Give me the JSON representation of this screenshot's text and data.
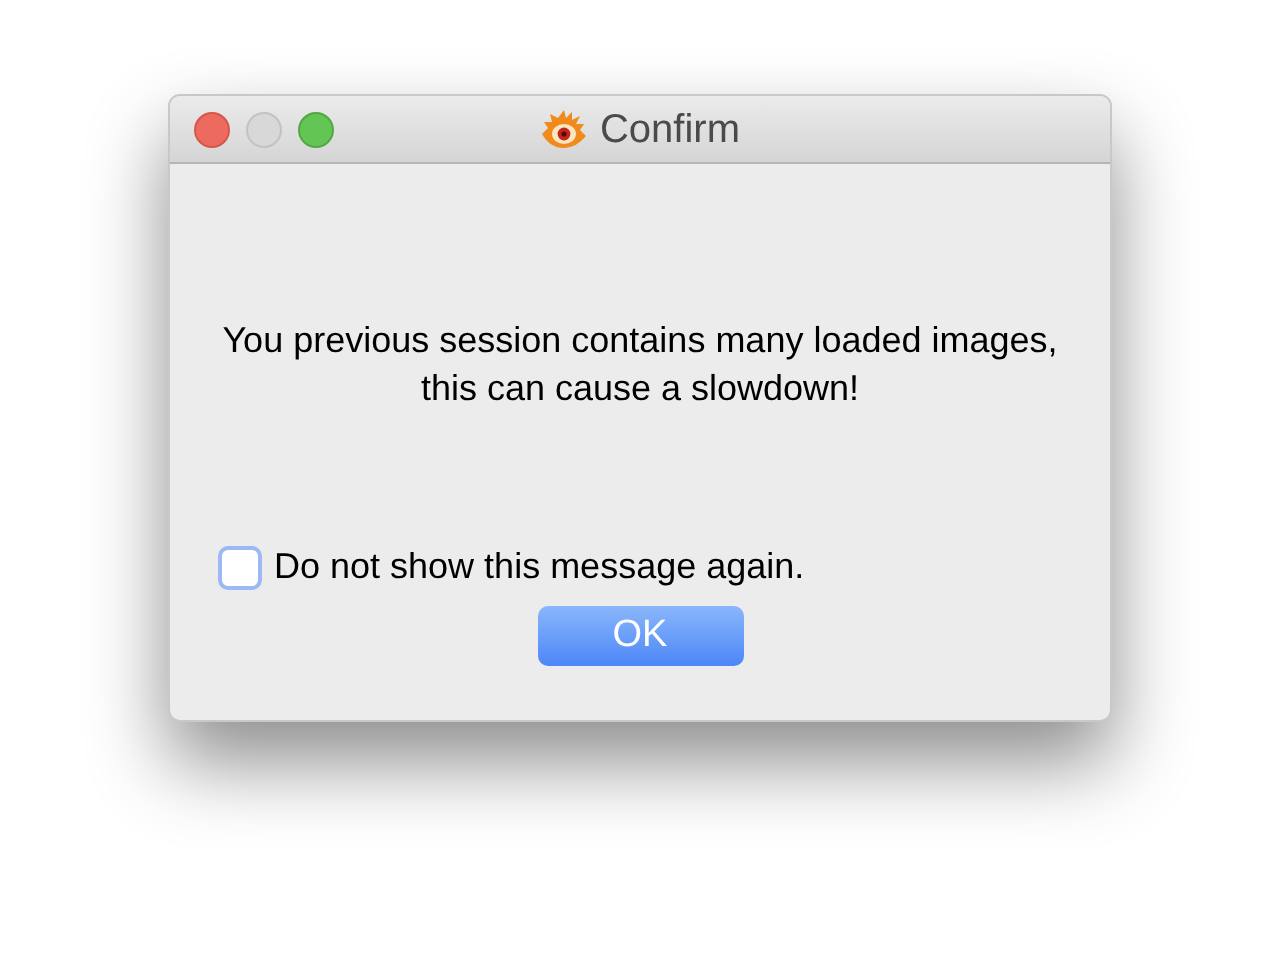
{
  "window": {
    "title": "Confirm"
  },
  "message": "You previous session contains many loaded images, this can cause a slowdown!",
  "checkbox": {
    "label": "Do not show this message again.",
    "checked": false
  },
  "buttons": [
    "OK"
  ]
}
